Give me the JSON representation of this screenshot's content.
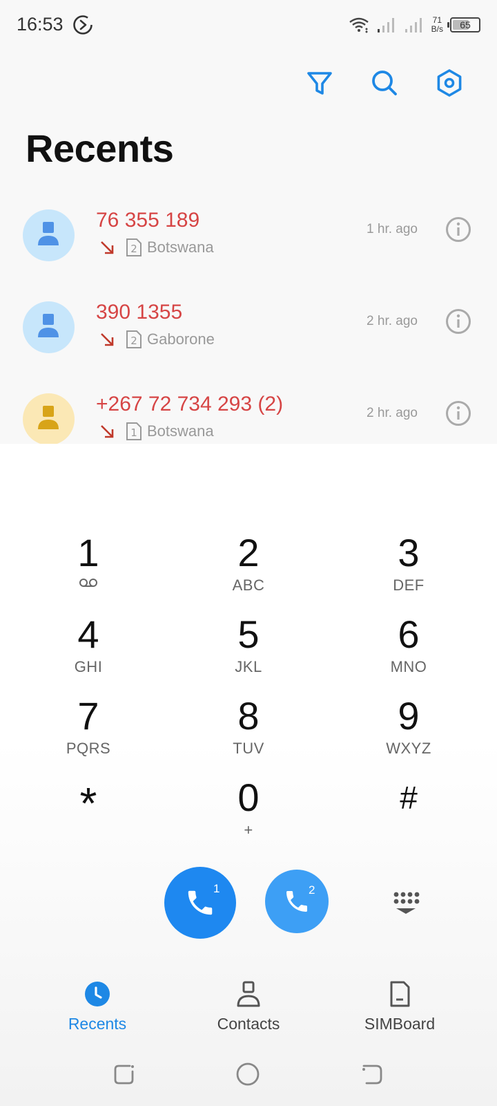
{
  "status_bar": {
    "time": "16:53",
    "speed_value": "71",
    "speed_unit": "B/s",
    "battery_level": "65"
  },
  "toolbar": {
    "filter_icon": "filter-icon",
    "search_icon": "search-icon",
    "settings_icon": "settings-icon"
  },
  "page_title": "Recents",
  "calls": [
    {
      "number": "76 355 189",
      "count": "",
      "sim": "2",
      "location": "Botswana",
      "time": "1 hr. ago",
      "avatar_color": "#c7e6fb",
      "avatar_icon_color": "#4f92e6",
      "type": "missed"
    },
    {
      "number": "390 1355",
      "count": "",
      "sim": "2",
      "location": "Gaborone",
      "time": "2 hr. ago",
      "avatar_color": "#c7e6fb",
      "avatar_icon_color": "#4f92e6",
      "type": "missed"
    },
    {
      "number": "+267 72 734 293",
      "count": "(2)",
      "sim": "1",
      "location": "Botswana",
      "time": "2 hr. ago",
      "avatar_color": "#fbe8b5",
      "avatar_icon_color": "#d8a418",
      "type": "missed"
    }
  ],
  "dialpad": {
    "keys": [
      {
        "digit": "1",
        "letters": ""
      },
      {
        "digit": "2",
        "letters": "ABC"
      },
      {
        "digit": "3",
        "letters": "DEF"
      },
      {
        "digit": "4",
        "letters": "GHI"
      },
      {
        "digit": "5",
        "letters": "JKL"
      },
      {
        "digit": "6",
        "letters": "MNO"
      },
      {
        "digit": "7",
        "letters": "PQRS"
      },
      {
        "digit": "8",
        "letters": "TUV"
      },
      {
        "digit": "9",
        "letters": "WXYZ"
      },
      {
        "digit": "*",
        "letters": ""
      },
      {
        "digit": "0",
        "letters": "+"
      },
      {
        "digit": "#",
        "letters": ""
      }
    ],
    "call_sim1_label": "1",
    "call_sim2_label": "2"
  },
  "bottom_nav": {
    "recents": "Recents",
    "contacts": "Contacts",
    "simboard": "SIMBoard"
  },
  "colors": {
    "accent": "#1e88e5",
    "missed": "#d64545",
    "call_button": "#1e88f0"
  }
}
